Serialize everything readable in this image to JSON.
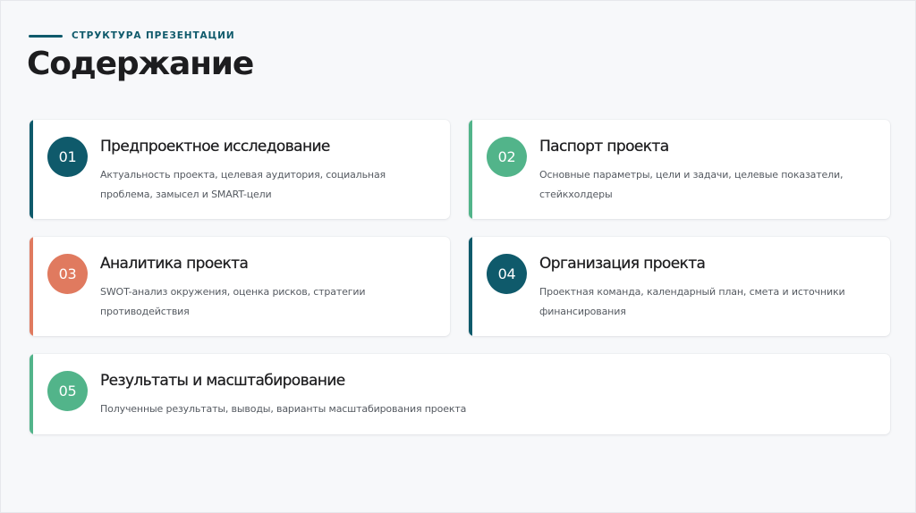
{
  "header": {
    "kicker": "СТРУКТУРА ПРЕЗЕНТАЦИИ",
    "title": "Содержание"
  },
  "colors": {
    "teal": "#0f5a6b",
    "green": "#52b48a",
    "coral": "#e07a5f"
  },
  "sections": [
    {
      "number": "01",
      "title": "Предпроектное исследование",
      "description": "Актуальность проекта, целевая аудитория, социальная проблема, замысел и SMART-цели",
      "color": "teal"
    },
    {
      "number": "02",
      "title": "Паспорт проекта",
      "description": "Основные параметры, цели и задачи, целевые показатели, стейкхолдеры",
      "color": "green"
    },
    {
      "number": "03",
      "title": "Аналитика проекта",
      "description": "SWOT-анализ окружения, оценка рисков, стратегии противодействия",
      "color": "coral"
    },
    {
      "number": "04",
      "title": "Организация проекта",
      "description": "Проектная команда, календарный план, смета и источники финансирования",
      "color": "teal"
    },
    {
      "number": "05",
      "title": "Результаты и масштабирование",
      "description": "Полученные результаты, выводы, варианты масштабирования проекта",
      "color": "green"
    }
  ]
}
